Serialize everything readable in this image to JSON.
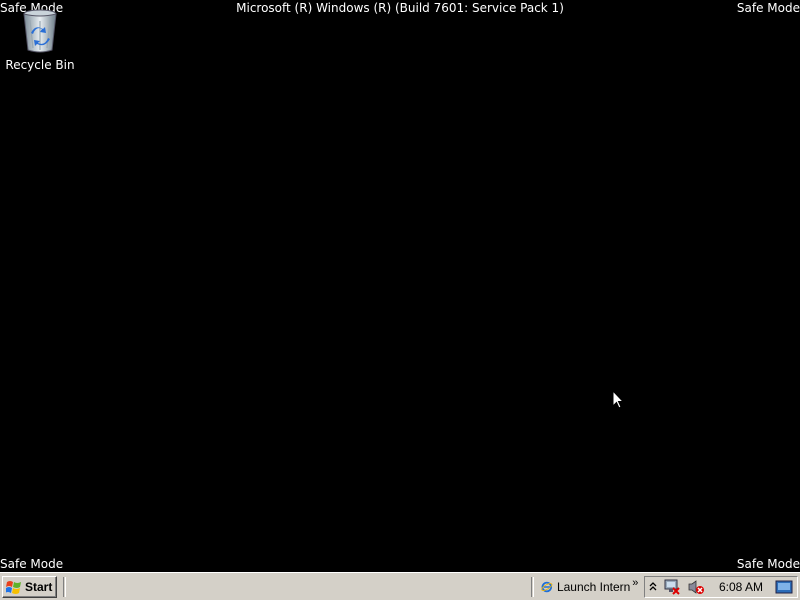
{
  "desktop": {
    "mode_label": "Safe Mode",
    "build_text": "Microsoft (R) Windows (R) (Build 7601: Service Pack 1)",
    "icons": [
      {
        "label": "Recycle Bin",
        "icon": "recycle-bin-icon"
      }
    ]
  },
  "taskbar": {
    "start_label": "Start",
    "task_button_label": "Launch Intern",
    "overflow_chevron": "»",
    "tray": {
      "show_hidden": "˄",
      "clock": "6:08 AM",
      "icons": [
        "network-error-icon",
        "volume-muted-icon",
        "show-desktop-icon"
      ]
    }
  },
  "colors": {
    "desktop_bg": "#000000",
    "taskbar_bg": "#d4d0c8",
    "text_white": "#ffffff"
  }
}
